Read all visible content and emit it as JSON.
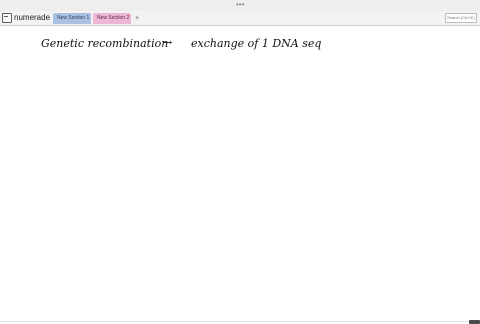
{
  "titlebar": {
    "dots": "•••"
  },
  "notebook": {
    "name": "numerade",
    "icon": "notebook-icon",
    "caret": "▼"
  },
  "tabs": [
    {
      "label": "New Section 1",
      "color": "#a9c1e2"
    },
    {
      "label": "New Section 2",
      "color": "#edb6d4"
    }
  ],
  "add_tab": "+",
  "search": {
    "placeholder": "Search (Ctrl+E)"
  },
  "page": {
    "handwriting": {
      "part1": "Genetic recombination",
      "arrow": "→",
      "part2": "exchange of 1 DNA seq"
    }
  },
  "colors": {
    "section1": "#a9c1e2",
    "section2": "#edb6d4",
    "ink": "#111111"
  }
}
